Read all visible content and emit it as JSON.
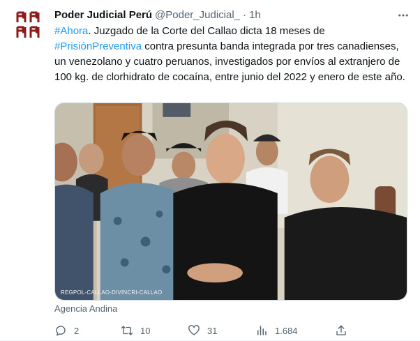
{
  "tweet": {
    "author_name": "Poder Judicial Perú",
    "handle": "@Poder_Judicial_",
    "separator": "·",
    "time": "1h",
    "text": {
      "hashtag1": "#Ahora",
      "part1": ". Juzgado de la Corte del Callao dicta 18 meses de ",
      "hashtag2": "#PrisiónPreventiva",
      "part2": " contra presunta banda integrada por tres canadienses, un venezolano y cuatro peruanos, investigados por envíos al extranjero de 100 kg. de clorhidrato de cocaína, entre junio del 2022 y enero de este año."
    },
    "media_watermark": "REGPOL-CALLAO-DIVINCRI-CALLAO",
    "media_source": "Agencia Andina",
    "stats": {
      "replies": "2",
      "retweets": "10",
      "likes": "31",
      "views": "1.684"
    }
  },
  "icons": {
    "avatar": "poder-judicial-logo",
    "more": "more-dots-icon",
    "reply": "reply-icon",
    "retweet": "retweet-icon",
    "like": "heart-icon",
    "views": "views-chart-icon",
    "share": "share-icon"
  },
  "colors": {
    "accent": "#1d9bf0",
    "text_primary": "#0f1419",
    "text_secondary": "#536471",
    "logo_red": "#8b1a1a"
  }
}
